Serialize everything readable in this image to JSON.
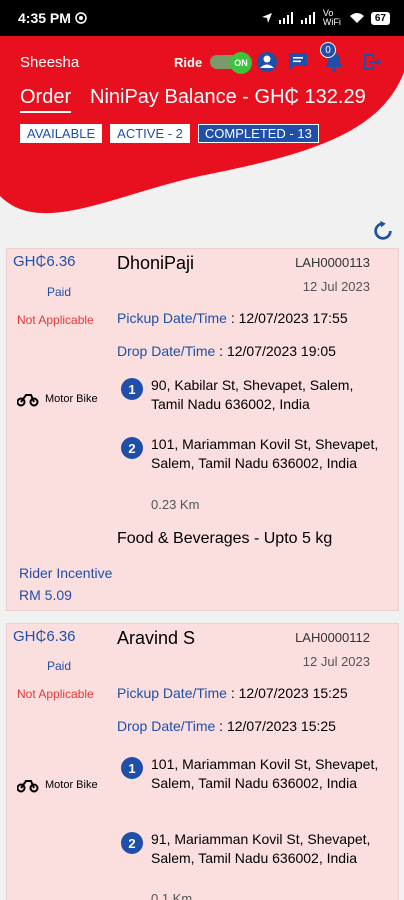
{
  "status_bar": {
    "time": "4:35 PM",
    "right_text": "Vo WiFi",
    "battery": "67"
  },
  "header": {
    "brand": "Sheesha",
    "ride_label": "Ride",
    "toggle_state": "ON",
    "notification_count": "0",
    "order_tab": "Order",
    "balance": "NiniPay Balance - GH₵ 132.29",
    "chips": [
      "AVAILABLE",
      "ACTIVE - 2",
      "COMPLETED - 13"
    ],
    "accent": "#e8101e",
    "brand_blue": "#1f4fa8"
  },
  "orders": [
    {
      "price": "GH₵6.36",
      "payment": "Paid",
      "status": "Not Applicable",
      "vehicle": "Motor Bike",
      "customer": "DhoniPaji",
      "order_id": "LAH0000113",
      "date": "12 Jul 2023",
      "pickup_label": "Pickup Date/Time",
      "pickup_value": " : 12/07/2023 17:55",
      "drop_label": "Drop Date/Time",
      "drop_value": " : 12/07/2023 19:05",
      "stops": [
        {
          "num": "1",
          "address": "90, Kabilar St, Shevapet, Salem, Tamil Nadu 636002, India"
        },
        {
          "num": "2",
          "address": "101, Mariamman Kovil St, Shevapet, Salem, Tamil Nadu 636002, India"
        }
      ],
      "distance": "0.23 Km",
      "goods": "Food & Beverages - Upto 5 kg",
      "incentive_label": "Rider Incentive",
      "incentive_value": "RM 5.09"
    },
    {
      "price": "GH₵6.36",
      "payment": "Paid",
      "status": "Not Applicable",
      "vehicle": "Motor Bike",
      "customer": "Aravind S",
      "order_id": "LAH0000112",
      "date": "12 Jul 2023",
      "pickup_label": "Pickup Date/Time",
      "pickup_value": " : 12/07/2023 15:25",
      "drop_label": "Drop Date/Time",
      "drop_value": " : 12/07/2023 15:25",
      "stops": [
        {
          "num": "1",
          "address": "101, Mariamman Kovil St, Shevapet, Salem, Tamil Nadu 636002, India"
        },
        {
          "num": "2",
          "address": "91, Mariamman Kovil St, Shevapet, Salem, Tamil Nadu 636002, India"
        }
      ],
      "distance": "0.1 Km"
    }
  ]
}
